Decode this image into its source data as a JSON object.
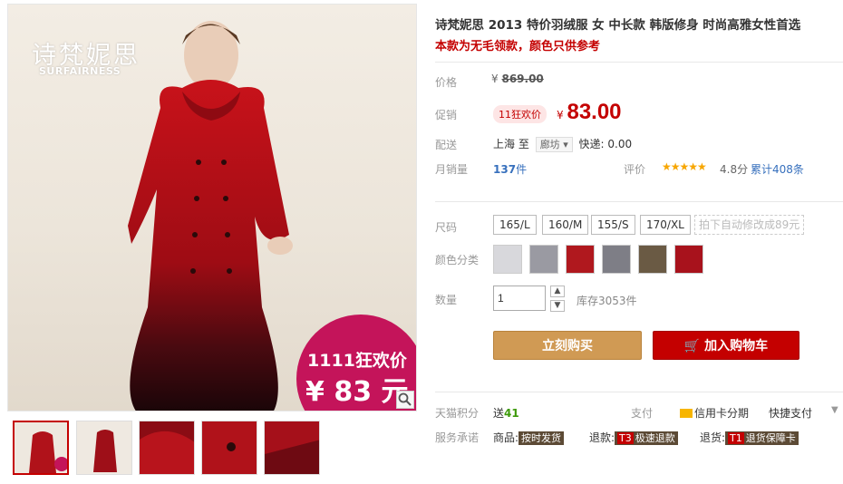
{
  "product": {
    "title": "诗梵妮思 2013 特价羽绒服 女 中长款 韩版修身 时尚高雅女性首选",
    "subtitle": "本款为无毛领款，颜色只供参考"
  },
  "brand": {
    "name_cn": "诗梵妮思",
    "name_en": "SURFAIRNESS"
  },
  "hero_promo": {
    "line1": "1111狂欢价",
    "line2": "¥ 83 元"
  },
  "price": {
    "label": "价格",
    "currency": "¥",
    "original": "869.00",
    "promo_label": "促销",
    "promo_tag": "11狂欢价",
    "promo_value": "83.00"
  },
  "shipping": {
    "label": "配送",
    "from": "上海",
    "to_word": "至",
    "city": "廊坊",
    "express": "快递: 0.00"
  },
  "sales": {
    "label": "月销量",
    "count": "137",
    "unit": "件",
    "rating_label": "评价",
    "stars": "★★★★★",
    "score": "4.8分",
    "reviews": "累计408条"
  },
  "sizes": {
    "label": "尺码",
    "options": [
      "165/L",
      "160/M",
      "155/S",
      "170/XL"
    ],
    "note": "拍下自动修改成89元"
  },
  "colors": {
    "label": "颜色分类",
    "swatches": [
      "#d8d8dc",
      "#9a9aa2",
      "#b0181e",
      "#7e7e86",
      "#6a5a44",
      "#a8121c"
    ]
  },
  "quantity": {
    "label": "数量",
    "value": "1",
    "stock": "库存3053件",
    "up": "▲",
    "down": "▼"
  },
  "buttons": {
    "buy_now": "立刻购买",
    "add_to_cart": "加入购物车",
    "cart_icon": "🛒"
  },
  "extras": {
    "points_label": "天猫积分",
    "points_prefix": "送",
    "points_value": "41",
    "pay_label": "支付",
    "credit": "信用卡分期",
    "quick_pay": "快捷支付",
    "caret": "▼",
    "promise_label": "服务承诺",
    "promise_items": [
      {
        "prefix": "商品:",
        "badge": "",
        "tag": "按时发货"
      },
      {
        "prefix": "退款:",
        "badge": "T3",
        "tag": "极速退款"
      },
      {
        "prefix": "退货:",
        "badge": "T1",
        "tag": "退货保障卡"
      }
    ]
  },
  "thumbnails": [
    "thumb-1",
    "thumb-2",
    "thumb-3",
    "thumb-4",
    "thumb-5"
  ]
}
